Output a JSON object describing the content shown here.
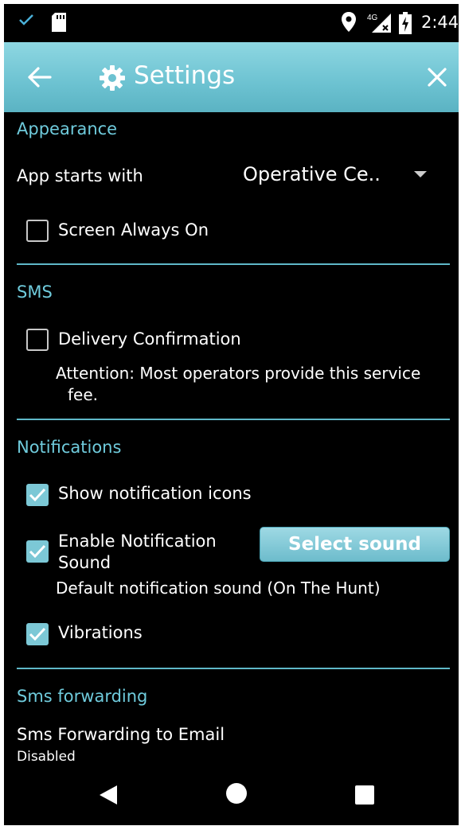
{
  "status_bar": {
    "time": "2:44",
    "network": "4G",
    "icons": [
      "check-icon",
      "sd-card-icon",
      "location-icon",
      "signal-icon",
      "battery-charging-icon"
    ]
  },
  "app_bar": {
    "title": "Settings",
    "icons": [
      "back-arrow-icon",
      "gear-icon",
      "close-icon"
    ]
  },
  "appearance": {
    "header": "Appearance",
    "app_starts_with_label": "App starts with",
    "app_starts_with_value": "Operative Ce..",
    "screen_always_on": {
      "label": "Screen Always On",
      "checked": false
    }
  },
  "sms": {
    "header": "SMS",
    "delivery_confirmation": {
      "label": "Delivery Confirmation",
      "checked": false
    },
    "note_line1": "Attention: Most operators provide this service",
    "note_line2": "fee."
  },
  "notifications": {
    "header": "Notifications",
    "show_icons": {
      "label": "Show notification icons",
      "checked": true
    },
    "enable_sound": {
      "label_line1": "Enable Notification",
      "label_line2": "Sound",
      "checked": true
    },
    "select_sound_button": "Select sound",
    "sound_note": "Default notification sound (On The Hunt)",
    "vibrations": {
      "label": "Vibrations",
      "checked": true
    }
  },
  "sms_forwarding": {
    "header": "Sms forwarding",
    "to_email_label": "Sms Forwarding to Email",
    "to_email_status": "Disabled"
  },
  "nav_bar": {
    "icons": [
      "nav-back-icon",
      "nav-home-icon",
      "nav-recents-icon"
    ]
  },
  "colors": {
    "accent": "#6fcbdc",
    "app_bar": "#6cc2d1",
    "checkbox_on": "#7cc8d6",
    "background": "#000000"
  }
}
